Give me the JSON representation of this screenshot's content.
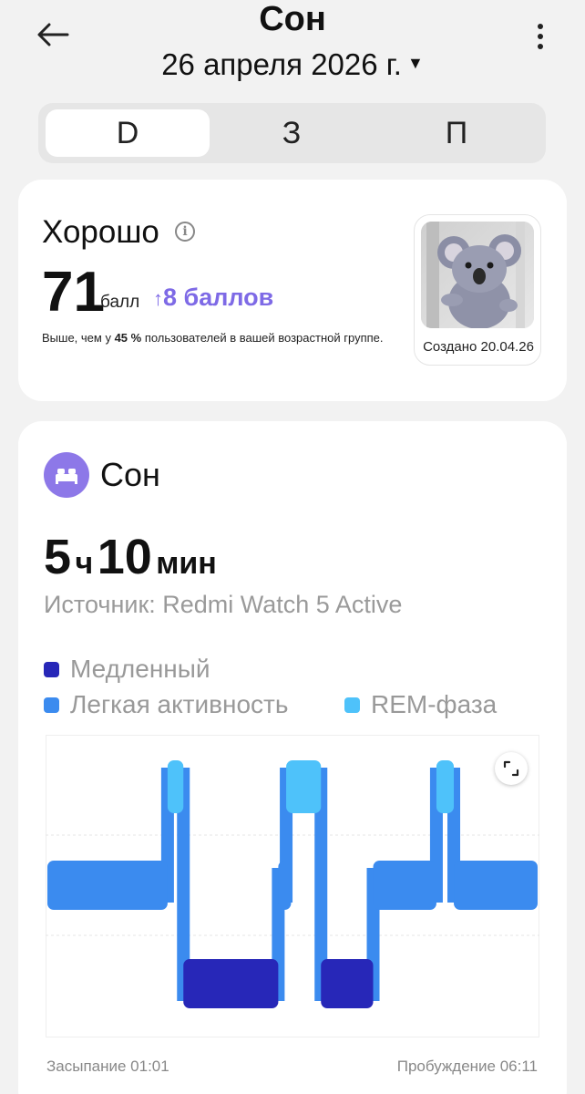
{
  "header": {
    "title": "Сон",
    "date": "26 апреля 2026 г."
  },
  "tabs": [
    {
      "label": "D",
      "active": true
    },
    {
      "label": "З",
      "active": false
    },
    {
      "label": "П",
      "active": false
    }
  ],
  "summary": {
    "rating": "Хорошо",
    "score": "71",
    "score_unit": "балл",
    "delta": "8 баллов",
    "compare_prefix": "Выше, чем у ",
    "compare_percent": "45 %",
    "compare_suffix": " пользователей в вашей возрастной группе.",
    "avatar_caption": "Создано 20.04.26"
  },
  "sleep": {
    "title": "Сон",
    "hours": "5",
    "hours_unit": "ч",
    "minutes": "10",
    "minutes_unit": "мин",
    "source": "Источник: Redmi Watch 5 Active",
    "start_label": "Засыпание 01:01",
    "end_label": "Пробуждение 06:11"
  },
  "legend": [
    {
      "label": "Медленный",
      "color": "#2727b8"
    },
    {
      "label": "Легкая активность",
      "color": "#3b8bef"
    },
    {
      "label": "REM-фаза",
      "color": "#4ec2fa"
    }
  ],
  "colors": {
    "deep": "#2727b8",
    "light": "#3b8bef",
    "rem": "#4ec2fa",
    "accent": "#7e6ae6"
  },
  "chart_data": {
    "type": "hypnogram",
    "x_start": "01:01",
    "x_end": "06:11",
    "levels": [
      "REM-фаза",
      "Легкая активность",
      "Медленный"
    ],
    "segments": [
      {
        "stage": "Легкая активность",
        "start": "01:01",
        "end": "02:17"
      },
      {
        "stage": "REM-фаза",
        "start": "02:17",
        "end": "02:27"
      },
      {
        "stage": "Медленный",
        "start": "02:27",
        "end": "03:27"
      },
      {
        "stage": "Легкая активность",
        "start": "03:27",
        "end": "03:32"
      },
      {
        "stage": "REM-фаза",
        "start": "03:32",
        "end": "03:54"
      },
      {
        "stage": "Медленный",
        "start": "03:54",
        "end": "04:27"
      },
      {
        "stage": "Легкая активность",
        "start": "04:27",
        "end": "05:07"
      },
      {
        "stage": "REM-фаза",
        "start": "05:07",
        "end": "05:18"
      },
      {
        "stage": "Легкая активность",
        "start": "05:18",
        "end": "06:11"
      }
    ]
  }
}
